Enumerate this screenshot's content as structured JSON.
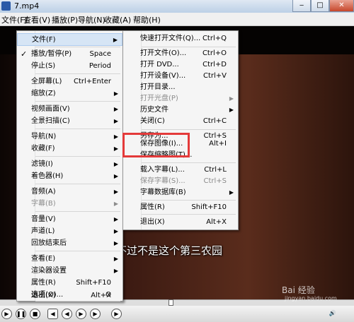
{
  "window": {
    "title": "7.mp4"
  },
  "menubar": [
    "文件(F)",
    "查看(V)",
    "播放(P)",
    "导航(N)",
    "收藏(A)",
    "帮助(H)"
  ],
  "context_menu": [
    {
      "label": "文件(F)",
      "submenu": true,
      "highlighted": true
    },
    {
      "label": "播放/暂停(P)",
      "shortcut": "Space",
      "checked": true
    },
    {
      "label": "停止(S)",
      "shortcut": "Period"
    },
    {
      "label": "全屏幕(L)",
      "shortcut": "Ctrl+Enter"
    },
    {
      "label": "缩放(Z)",
      "submenu": true
    },
    {
      "label": "视频画面(V)",
      "submenu": true
    },
    {
      "label": "全景扫描(C)",
      "submenu": true
    },
    {
      "label": "导航(N)",
      "submenu": true
    },
    {
      "label": "收藏(F)",
      "submenu": true
    },
    {
      "label": "滤镜(I)",
      "submenu": true
    },
    {
      "label": "着色器(H)",
      "submenu": true
    },
    {
      "label": "音频(A)",
      "submenu": true
    },
    {
      "label": "字幕(B)",
      "submenu": true,
      "disabled": true
    },
    {
      "label": "音量(V)",
      "submenu": true
    },
    {
      "label": "声道(L)",
      "submenu": true
    },
    {
      "label": "回放结束后",
      "submenu": true
    },
    {
      "label": "查看(E)",
      "submenu": true
    },
    {
      "label": "渲染器设置",
      "submenu": true
    },
    {
      "label": "属性(R)",
      "shortcut": "Shift+F10"
    },
    {
      "label": "选项(O)...",
      "shortcut": "O"
    },
    {
      "label": "退出(X)",
      "shortcut": "Alt+X"
    }
  ],
  "file_submenu": [
    {
      "label": "快速打开文件(Q)...",
      "shortcut": "Ctrl+Q"
    },
    {
      "label": "打开文件(O)...",
      "shortcut": "Ctrl+O"
    },
    {
      "label": "打开 DVD...",
      "shortcut": "Ctrl+D"
    },
    {
      "label": "打开设备(V)...",
      "shortcut": "Ctrl+V"
    },
    {
      "label": "打开目录..."
    },
    {
      "label": "打开光盘(P)",
      "submenu": true,
      "disabled": true
    },
    {
      "label": "历史文件",
      "submenu": true
    },
    {
      "label": "关闭(C)",
      "shortcut": "Ctrl+C"
    },
    {
      "label": "另存为...",
      "shortcut": "Ctrl+S"
    },
    {
      "label": "保存图像(I)...",
      "shortcut": "Alt+I"
    },
    {
      "label": "保存缩略图(T)..."
    },
    {
      "label": "载入字幕(L)...",
      "shortcut": "Ctrl+L"
    },
    {
      "label": "保存字幕(S)...",
      "shortcut": "Ctrl+S",
      "disabled": true
    },
    {
      "label": "字幕数据库(B)",
      "submenu": true
    },
    {
      "label": "属性(R)",
      "shortcut": "Shift+F10"
    },
    {
      "label": "退出(X)",
      "shortcut": "Alt+X"
    }
  ],
  "subtitle": "不过不是这个第三农园",
  "watermark": {
    "text": "Bai 经验",
    "sub": "jingyan.baidu.com"
  },
  "colors": {
    "highlight": "#d6e5f5",
    "red_box": "#e43a3a"
  }
}
